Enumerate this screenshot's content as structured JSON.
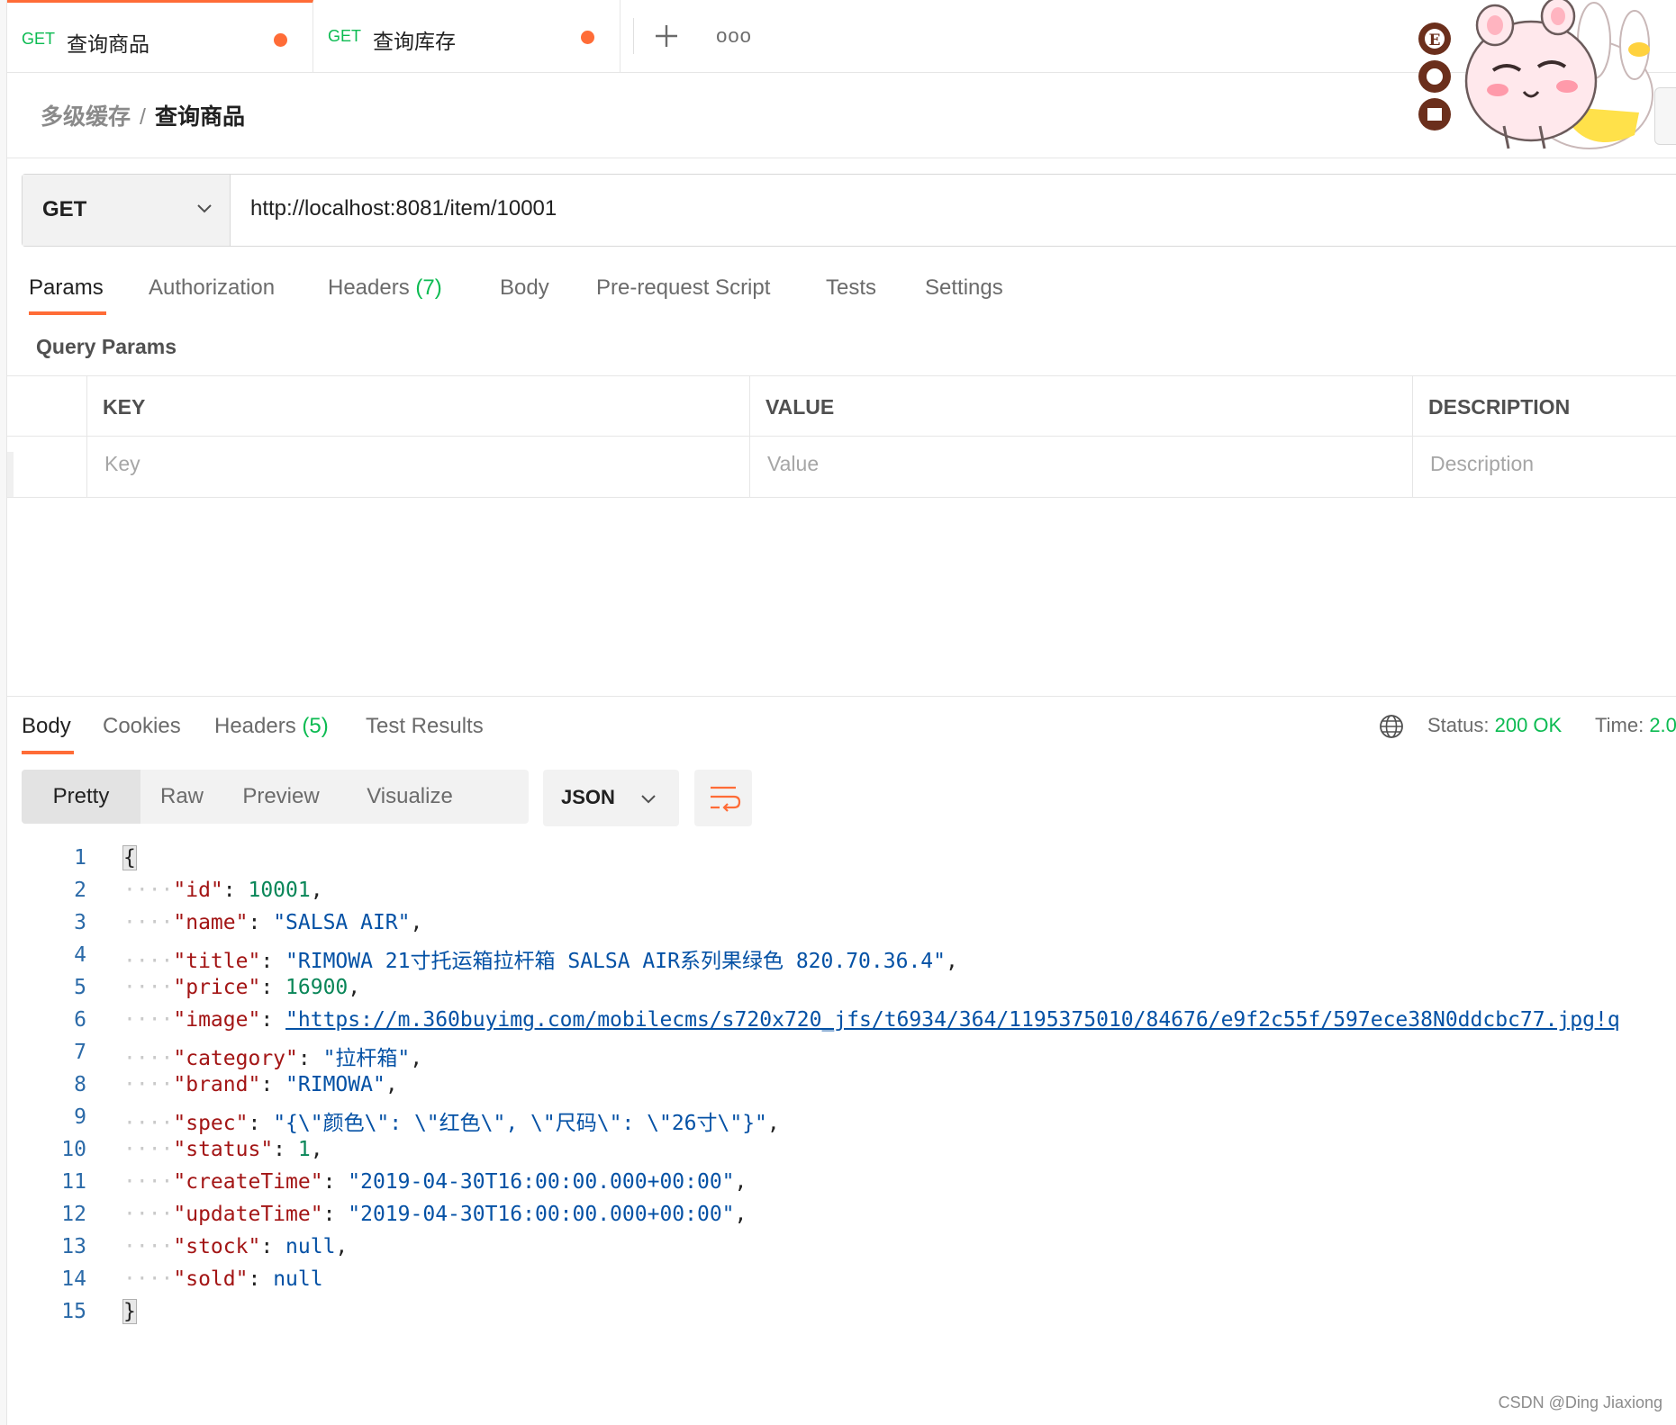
{
  "tabs": [
    {
      "method": "GET",
      "title": "查询商品"
    },
    {
      "method": "GET",
      "title": "查询库存"
    }
  ],
  "tab_more": "ooo",
  "breadcrumb": {
    "parent": "多级缓存",
    "separator": "/",
    "current": "查询商品"
  },
  "request": {
    "method": "GET",
    "url": "http://localhost:8081/item/10001"
  },
  "req_tabs": {
    "params": "Params",
    "authorization": "Authorization",
    "headers": "Headers",
    "headers_count": "(7)",
    "body": "Body",
    "prerequest": "Pre-request Script",
    "tests": "Tests",
    "settings": "Settings"
  },
  "query_params": {
    "title": "Query Params",
    "headers": {
      "key": "KEY",
      "value": "VALUE",
      "description": "DESCRIPTION"
    },
    "placeholders": {
      "key": "Key",
      "value": "Value",
      "description": "Description"
    }
  },
  "response": {
    "tabs": {
      "body": "Body",
      "cookies": "Cookies",
      "headers": "Headers",
      "headers_count": "(5)",
      "test_results": "Test Results"
    },
    "status_label": "Status:",
    "status_value": "200 OK",
    "time_label": "Time:",
    "time_value": "2.0",
    "views": {
      "pretty": "Pretty",
      "raw": "Raw",
      "preview": "Preview",
      "visualize": "Visualize"
    },
    "format": "JSON",
    "line_numbers": [
      "1",
      "2",
      "3",
      "4",
      "5",
      "6",
      "7",
      "8",
      "9",
      "10",
      "11",
      "12",
      "13",
      "14",
      "15"
    ],
    "json": {
      "open": "{",
      "close": "}",
      "id_key": "\"id\"",
      "id_val": "10001",
      "name_key": "\"name\"",
      "name_val": "\"SALSA AIR\"",
      "title_key": "\"title\"",
      "title_val": "\"RIMOWA 21寸托运箱拉杆箱 SALSA AIR系列果绿色 820.70.36.4\"",
      "price_key": "\"price\"",
      "price_val": "16900",
      "image_key": "\"image\"",
      "image_val": "\"https://m.360buyimg.com/mobilecms/s720x720_jfs/t6934/364/1195375010/84676/e9f2c55f/597ece38N0ddcbc77.jpg!q",
      "category_key": "\"category\"",
      "category_val": "\"拉杆箱\"",
      "brand_key": "\"brand\"",
      "brand_val": "\"RIMOWA\"",
      "spec_key": "\"spec\"",
      "spec_val": "\"{\\\"颜色\\\": \\\"红色\\\", \\\"尺码\\\": \\\"26寸\\\"}\"",
      "status_key": "\"status\"",
      "status_val": "1",
      "createTime_key": "\"createTime\"",
      "createTime_val": "\"2019-04-30T16:00:00.000+00:00\"",
      "updateTime_key": "\"updateTime\"",
      "updateTime_val": "\"2019-04-30T16:00:00.000+00:00\"",
      "stock_key": "\"stock\"",
      "stock_val": "null",
      "sold_key": "\"sold\"",
      "sold_val": "null"
    }
  },
  "sticker_letters": [
    "E"
  ],
  "watermark": "CSDN @Ding Jiaxiong",
  "colors": {
    "accent": "#ff6c37",
    "get_green": "#0cbb52",
    "json_key": "#a31515",
    "json_string": "#0451a5",
    "json_number": "#098658"
  }
}
